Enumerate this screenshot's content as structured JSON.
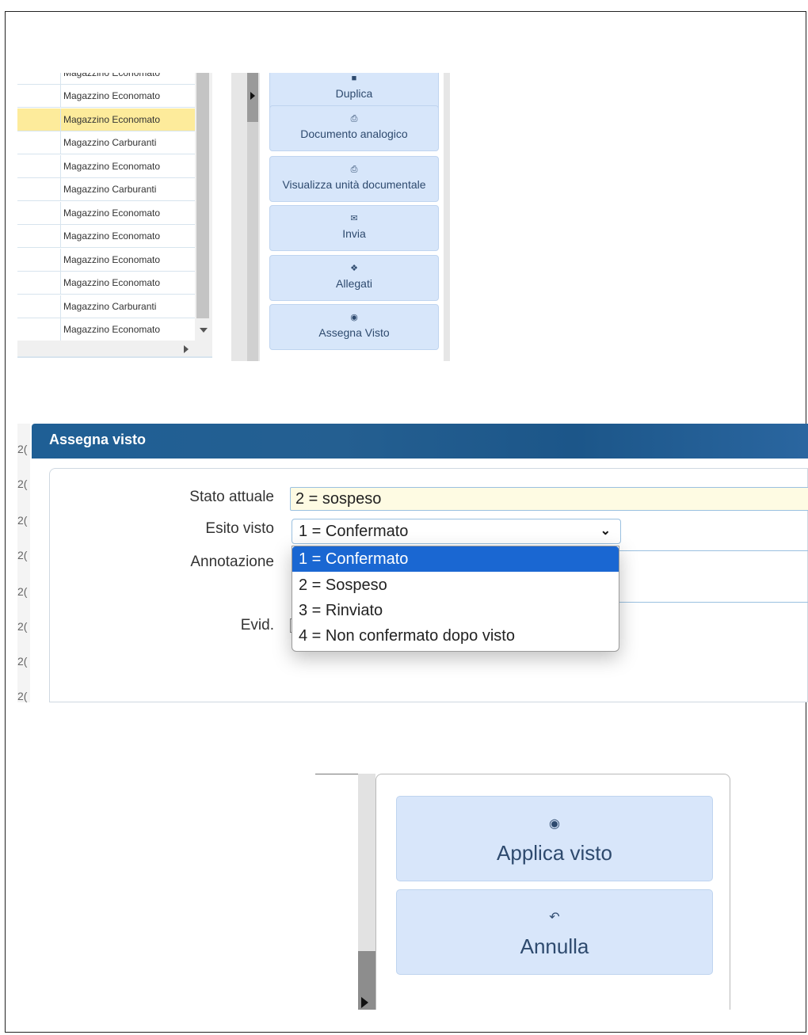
{
  "list": {
    "partial_top": "Magazzino Economato",
    "rows": [
      {
        "label": "Magazzino Economato",
        "selected": false
      },
      {
        "label": "Magazzino Economato",
        "selected": true
      },
      {
        "label": "Magazzino Carburanti",
        "selected": false
      },
      {
        "label": "Magazzino Economato",
        "selected": false
      },
      {
        "label": "Magazzino Carburanti",
        "selected": false
      },
      {
        "label": "Magazzino Economato",
        "selected": false
      },
      {
        "label": "Magazzino Economato",
        "selected": false
      },
      {
        "label": "Magazzino Economato",
        "selected": false
      },
      {
        "label": "Magazzino Economato",
        "selected": false
      },
      {
        "label": "Magazzino Carburanti",
        "selected": false
      },
      {
        "label": "Magazzino Economato",
        "selected": false
      }
    ]
  },
  "actions": {
    "duplica": "Duplica",
    "documento_analogico": "Documento analogico",
    "visualizza_unita": "Visualizza unità documentale",
    "invia": "Invia",
    "allegati": "Allegati",
    "assegna_visto": "Assegna Visto"
  },
  "dialog": {
    "title": "Assegna visto",
    "stato_attuale_label": "Stato attuale",
    "stato_attuale_value": "2 = sospeso",
    "esito_visto_label": "Esito visto",
    "esito_visto_value": "1 = Confermato",
    "annotazione_label": "Annotazione",
    "evid_label": "Evid.",
    "options": [
      "1 = Confermato",
      "2 = Sospeso",
      "3 = Rinviato",
      "4 = Non confermato dopo visto"
    ],
    "selected_option": "1 = Confermato"
  },
  "bottom_actions": {
    "applica_visto": "Applica visto",
    "annulla": "Annulla"
  },
  "colors": {
    "header": "#1f5f95",
    "button_bg": "#d7e6fa",
    "selected_row": "#fdeb9b",
    "dropdown_selected": "#1a67d2",
    "input_yellow": "#fefbe3"
  }
}
